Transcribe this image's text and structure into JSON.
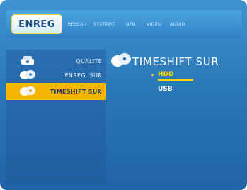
{
  "header": {
    "tabs": [
      {
        "label": "ENREG",
        "active": true
      },
      {
        "label": "RESEAU",
        "active": false
      },
      {
        "label": "SYSTEME",
        "active": false
      },
      {
        "label": "INFO",
        "active": false
      },
      {
        "label": "VIDEO",
        "active": false
      },
      {
        "label": "AUDIO",
        "active": false
      }
    ]
  },
  "sidebar": {
    "items": [
      {
        "label": "QUALITE",
        "icon": "quality-icon",
        "active": false
      },
      {
        "label": "ENREG. SUR",
        "icon": "record-disc-icon",
        "active": false
      },
      {
        "label": "TIMESHIFT SUR",
        "icon": "timeshift-disc-icon",
        "active": true
      }
    ]
  },
  "main": {
    "title": "TIMESHIFT SUR",
    "title_icon": "timeshift-disc-icon",
    "options": [
      {
        "label": "HDD",
        "selected": true
      },
      {
        "label": "USB",
        "selected": false
      }
    ]
  },
  "colors": {
    "accent": "#f5b400",
    "selected_text": "#ffd400",
    "background": "#2b78b9"
  }
}
